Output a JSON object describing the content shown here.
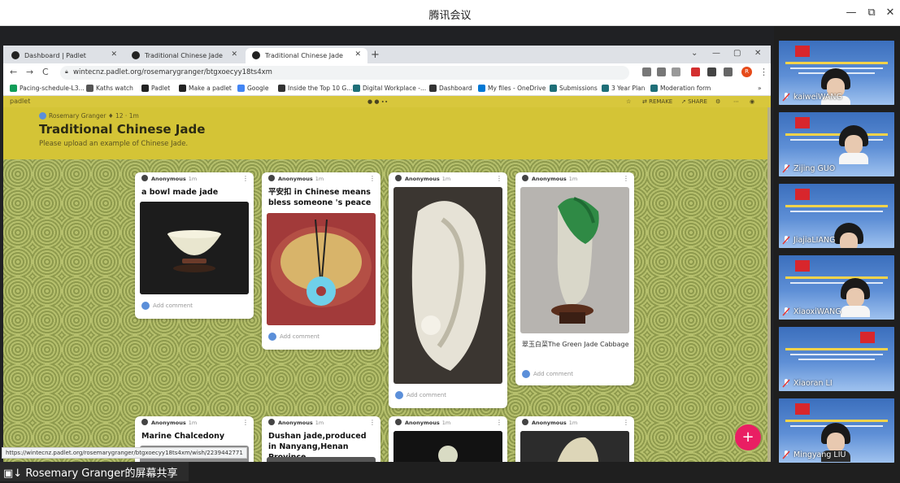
{
  "meeting": {
    "title": "腾讯会议",
    "controls": [
      "—",
      "⧉",
      "✕"
    ],
    "sharer_label": "Rosemary Granger的屏幕共享"
  },
  "browser": {
    "tabs": [
      {
        "label": "Dashboard | Padlet",
        "active": false
      },
      {
        "label": "Traditional Chinese Jade",
        "active": false
      },
      {
        "label": "Traditional Chinese Jade",
        "active": true
      }
    ],
    "new_tab": "+",
    "url": "wintecnz.padlet.org/rosemarygranger/btgxoecyy18ts4xm",
    "profile_initial": "R",
    "bookmarks": [
      {
        "label": "Pacing-schedule-L3...",
        "color": "#0f9d58"
      },
      {
        "label": "Kaths watch",
        "color": "#555555"
      },
      {
        "label": "Padlet",
        "color": "#222222"
      },
      {
        "label": "Make a padlet",
        "color": "#222222"
      },
      {
        "label": "Google",
        "color": "#4285f4"
      },
      {
        "label": "Inside the Top 10 G...",
        "color": "#333333"
      },
      {
        "label": "Digital Workplace -...",
        "color": "#1f6f78"
      },
      {
        "label": "Dashboard",
        "color": "#333333"
      },
      {
        "label": "My files - OneDrive",
        "color": "#0078d4"
      },
      {
        "label": "Submissions",
        "color": "#1f6f78"
      },
      {
        "label": "3 Year Plan",
        "color": "#1f6f78"
      },
      {
        "label": "Moderation form",
        "color": "#1f6f78"
      }
    ],
    "status_url": "https://wintecnz.padlet.org/rosemarygranger/btgxoecyy18ts4xm/wish/2239442771"
  },
  "padlet": {
    "logo": "padlet",
    "actions": {
      "remake": "REMAKE",
      "share": "SHARE"
    },
    "author": "Rosemary Granger",
    "author_meta": "♦ 12 · 1m",
    "title": "Traditional Chinese Jade",
    "description": "Please upload an example of Chinese Jade.",
    "cards": [
      {
        "author": "Anonymous",
        "time": "1m",
        "title": "a bowl made jade",
        "caption": "",
        "comment": "Add comment"
      },
      {
        "author": "Anonymous",
        "time": "1m",
        "title": "平安扣 in Chinese means bless someone 's peace",
        "caption": "",
        "comment": "Add comment"
      },
      {
        "author": "Anonymous",
        "time": "1m",
        "title": "",
        "caption": "",
        "comment": "Add comment"
      },
      {
        "author": "Anonymous",
        "time": "1m",
        "title": "",
        "caption": "翠玉白菜The Green Jade Cabbage",
        "comment": "Add comment"
      },
      {
        "author": "Anonymous",
        "time": "1m",
        "title": "Marine Chalcedony",
        "caption": "",
        "comment": ""
      },
      {
        "author": "Anonymous",
        "time": "1m",
        "title": "Dushan jade,produced in Nanyang,Henan Province.",
        "caption": "",
        "comment": ""
      },
      {
        "author": "Anonymous",
        "time": "1m",
        "title": "",
        "caption": "",
        "comment": ""
      },
      {
        "author": "Anonymous",
        "time": "1m",
        "title": "",
        "caption": "",
        "comment": ""
      }
    ],
    "fab": "+"
  },
  "participants": [
    {
      "name": "kaiweiWANG"
    },
    {
      "name": "Zijing GUO"
    },
    {
      "name": "JiajiaLIANG"
    },
    {
      "name": "XiaoxiWANG"
    },
    {
      "name": "Xiaoran LI"
    },
    {
      "name": "Mingyang LIU"
    }
  ]
}
